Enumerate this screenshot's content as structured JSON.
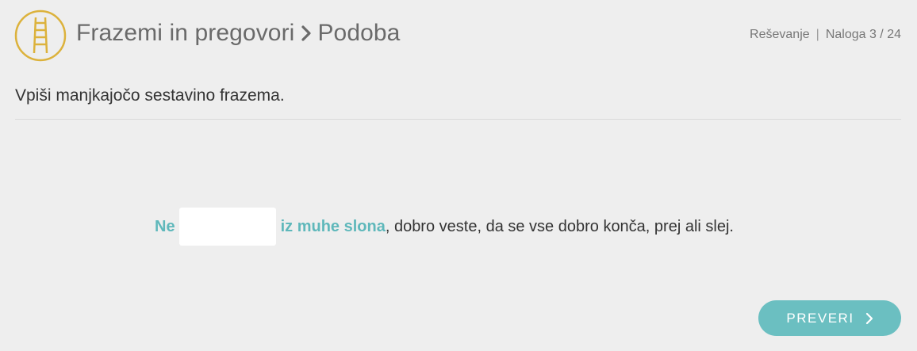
{
  "header": {
    "logo_icon": "ladder-icon",
    "title_main": "Frazemi in pregovori",
    "title_separator_icon": "chevron-right-icon",
    "title_sub": "Podoba",
    "mode": "Reševanje",
    "separator": "|",
    "task_counter": "Naloga 3 / 24"
  },
  "task": {
    "instruction": "Vpiši manjkajočo sestavino frazema.",
    "phrase_before": "Ne",
    "blank_value": "",
    "phrase_after": "iz muhe slona",
    "sentence_rest": ", dobro veste, da se vse dobro konča, prej ali slej."
  },
  "actions": {
    "check_label": "PREVERI",
    "check_icon": "chevron-right-icon"
  },
  "colors": {
    "background": "#eeeeee",
    "accent": "#6bbfc1",
    "phrase": "#5fb8bb",
    "logo": "#dcb23c"
  }
}
